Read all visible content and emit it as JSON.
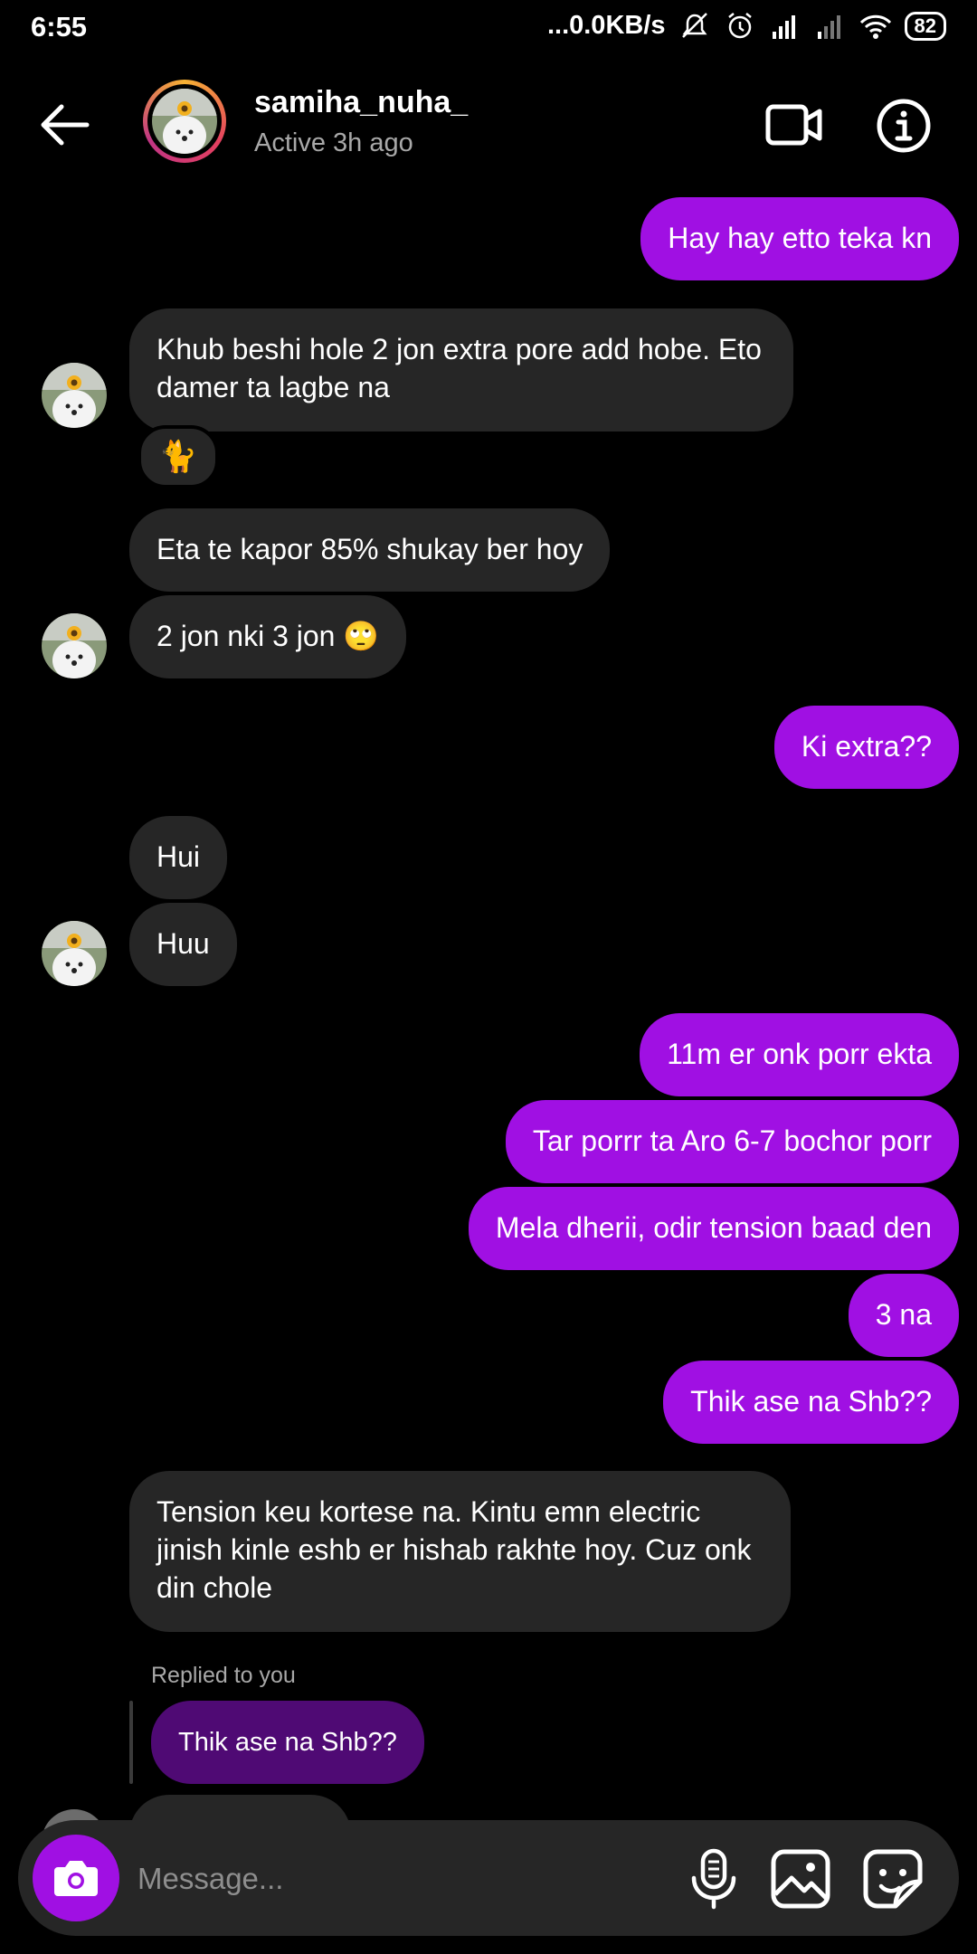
{
  "status_bar": {
    "time": "6:55",
    "network_speed": "...0.0KB/s",
    "battery": "82"
  },
  "header": {
    "username": "samiha_nuha_",
    "activity": "Active 3h ago",
    "icons": [
      "back-arrow-icon",
      "video-call-icon",
      "info-icon"
    ]
  },
  "messages": [
    {
      "from": "me",
      "text": "Hay hay etto teka kn"
    },
    {
      "from": "them",
      "text": "Khub beshi hole 2 jon extra pore add hobe. Eto damer ta lagbe na",
      "reaction": "🐈"
    },
    {
      "from": "them",
      "text": "Eta te kapor 85% shukay ber hoy"
    },
    {
      "from": "them",
      "text": "2 jon nki 3 jon 🙄"
    },
    {
      "from": "me",
      "text": "Ki extra??"
    },
    {
      "from": "them",
      "text": "Hui"
    },
    {
      "from": "them",
      "text": "Huu"
    },
    {
      "from": "me",
      "text": "11m er onk porr ekta"
    },
    {
      "from": "me",
      "text": "Tar porrr ta Aro 6-7 bochor porr"
    },
    {
      "from": "me",
      "text": "Mela dherii, odir tension baad den"
    },
    {
      "from": "me",
      "text": "3 na"
    },
    {
      "from": "me",
      "text": "Thik ase na Shb??"
    },
    {
      "from": "them",
      "text": "Tension keu kortese na. Kintu emn electric jinish kinle eshb er hishab rakhte hoy. Cuz onk din chole"
    }
  ],
  "reply": {
    "label": "Replied to you",
    "quoted": "Thik ase na Shb??"
  },
  "composer": {
    "placeholder": "Message...",
    "icons": [
      "camera-icon",
      "microphone-icon",
      "gallery-icon",
      "sticker-icon"
    ]
  },
  "colors": {
    "outgoing": "#a010e3",
    "incoming": "#262626",
    "reply_quote": "#4f0a74",
    "background": "#000000"
  }
}
